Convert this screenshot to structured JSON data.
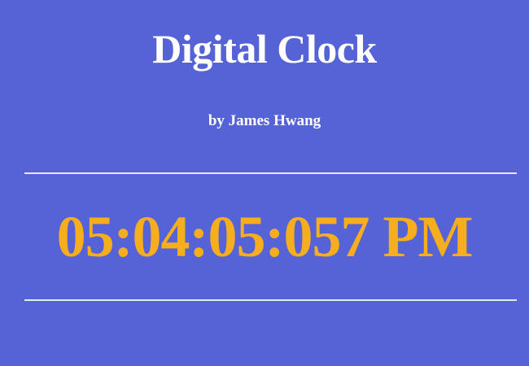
{
  "header": {
    "title": "Digital Clock",
    "byline": "by James Hwang"
  },
  "clock": {
    "time": "05:04:05:057 PM"
  },
  "colors": {
    "background": "#5563d6",
    "text": "#ffffff",
    "clock": "#f6ae1e",
    "rule": "#e6e8f6"
  }
}
